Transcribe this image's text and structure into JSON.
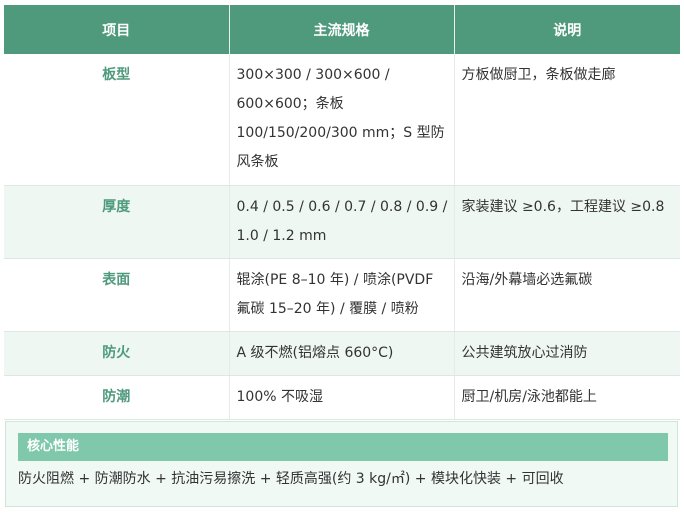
{
  "table": {
    "headers": [
      "项目",
      "主流规格",
      "说明"
    ],
    "rows": [
      {
        "item": "板型",
        "spec": "300×300 / 300×600 / 600×600；条板 100/150/200/300 mm；S 型防风条板",
        "note": "方板做厨卫，条板做走廊"
      },
      {
        "item": "厚度",
        "spec": "0.4 / 0.5 / 0.6 / 0.7 / 0.8 / 0.9 / 1.0 / 1.2 mm",
        "note": "家装建议 ≥0.6，工程建议 ≥0.8"
      },
      {
        "item": "表面",
        "spec": "辊涂(PE 8–10 年) / 喷涂(PVDF 氟碳 15–20 年) / 覆膜 / 喷粉",
        "note": "沿海/外幕墙必选氟碳"
      },
      {
        "item": "防火",
        "spec": "A 级不燃(铝熔点 660°C)",
        "note": "公共建筑放心过消防"
      },
      {
        "item": "防潮",
        "spec": "100% 不吸湿",
        "note": "厨卫/机房/泳池都能上"
      }
    ]
  },
  "core": {
    "title": "核心性能",
    "text": "防火阻燃 + 防潮防水 + 抗油污易擦洗 + 轻质高强(约 3 kg/㎡) + 模块化快装 + 可回收"
  }
}
